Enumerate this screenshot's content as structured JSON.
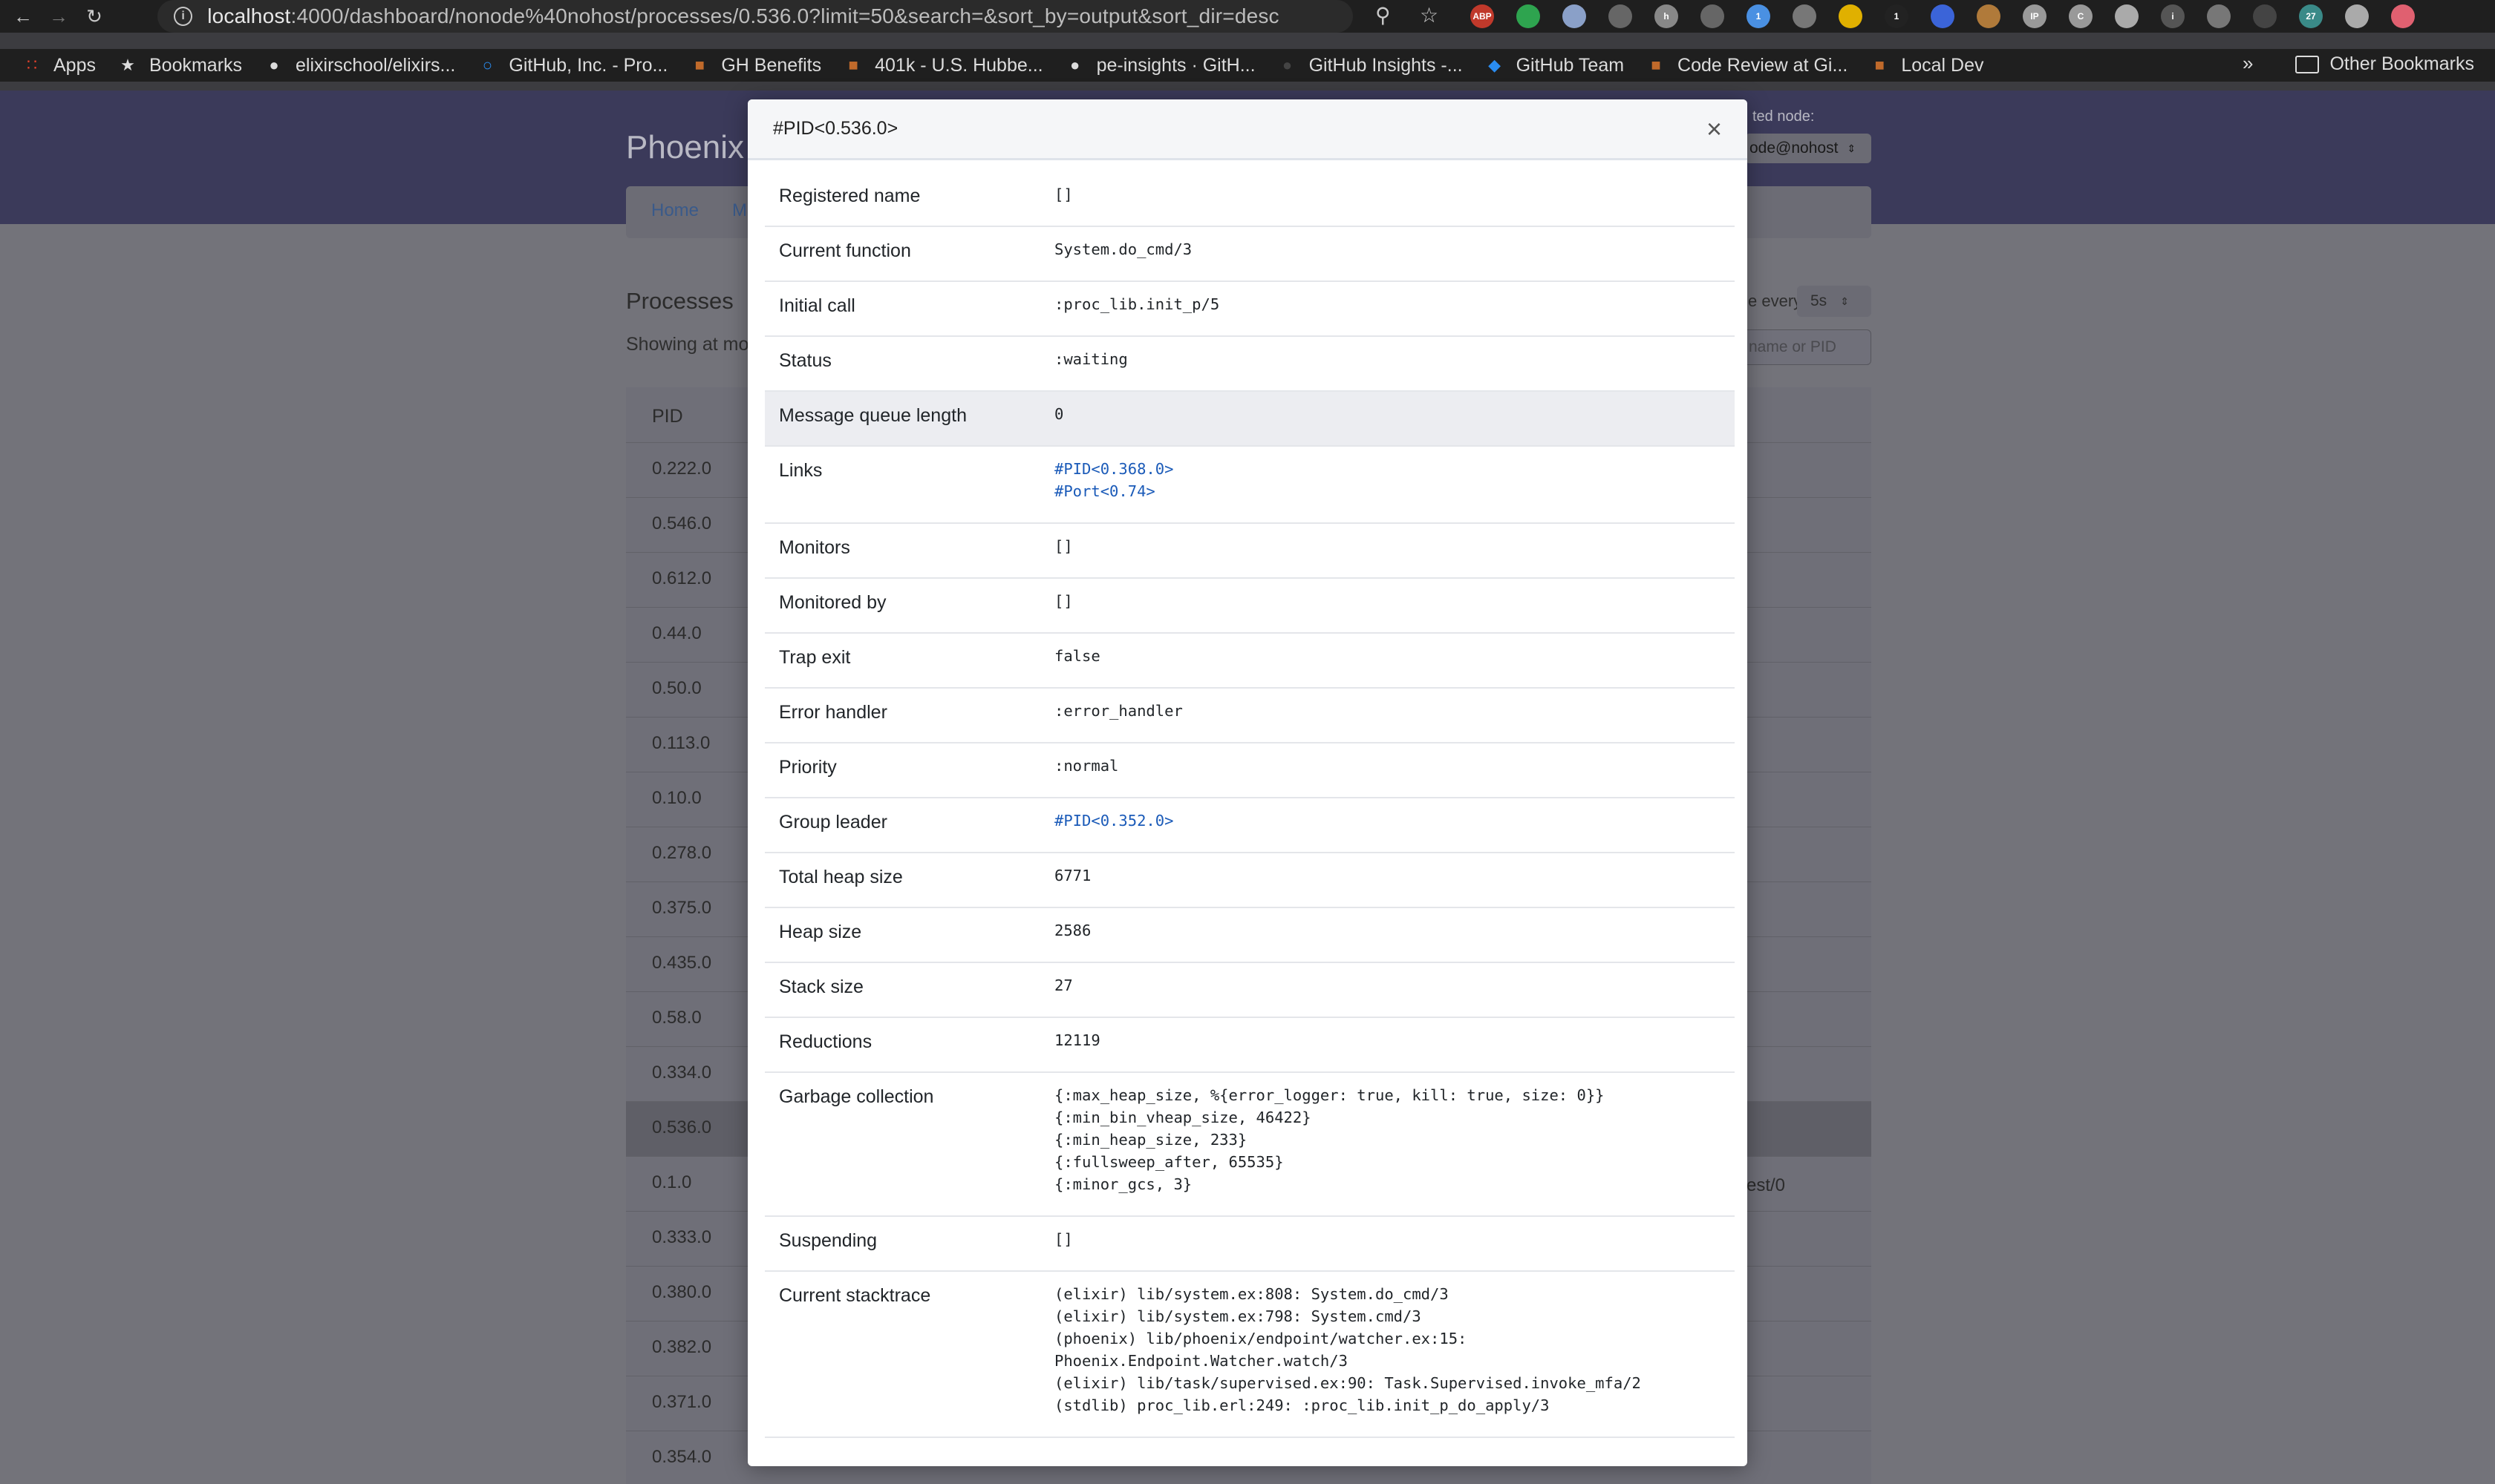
{
  "browser": {
    "url_host": "localhost",
    "url_path": ":4000/dashboard/nonode%40nohost/processes/0.536.0?limit=50&search=&sort_by=output&sort_dir=desc",
    "bookmarks": [
      {
        "label": "Apps",
        "icon": "apps-grid-icon",
        "color": "#e0402b"
      },
      {
        "label": "Bookmarks",
        "icon": "star-icon",
        "color": "#dcdcdc"
      },
      {
        "label": "elixirschool/elixirs...",
        "icon": "github-icon",
        "color": "#dcdcdc"
      },
      {
        "label": "GitHub, Inc. - Pro...",
        "icon": "ring-icon",
        "color": "#2a8cf0"
      },
      {
        "label": "GH Benefits",
        "icon": "folder-badge-icon",
        "color": "#c06a2b"
      },
      {
        "label": "401k - U.S. Hubbe...",
        "icon": "folder-badge-icon",
        "color": "#c06a2b"
      },
      {
        "label": "pe-insights · GitH...",
        "icon": "github-icon",
        "color": "#dcdcdc"
      },
      {
        "label": "GitHub Insights -...",
        "icon": "github-icon",
        "color": "#444"
      },
      {
        "label": "GitHub Team",
        "icon": "octocat-icon",
        "color": "#2a8cf0"
      },
      {
        "label": "Code Review at Gi...",
        "icon": "folder-badge-icon",
        "color": "#c06a2b"
      },
      {
        "label": "Local Dev",
        "icon": "folder-badge-icon",
        "color": "#c06a2b"
      }
    ],
    "other_bookmarks": "Other Bookmarks",
    "extensions": [
      {
        "name": "abp-icon",
        "text": "ABP",
        "color": "#c0392b"
      },
      {
        "name": "green-dot-icon",
        "text": "",
        "color": "#2ea44f"
      },
      {
        "name": "owl-icon",
        "text": "",
        "color": "#8aa0c8"
      },
      {
        "name": "target-icon",
        "text": "",
        "color": "#666"
      },
      {
        "name": "h-icon",
        "text": "h",
        "color": "#888"
      },
      {
        "name": "react-icon",
        "text": "",
        "color": "#666"
      },
      {
        "name": "chat-icon",
        "text": "1",
        "color": "#4a90e2"
      },
      {
        "name": "soccer-icon",
        "text": "",
        "color": "#777"
      },
      {
        "name": "flag-icon",
        "text": "",
        "color": "#e0b000"
      },
      {
        "name": "onepassword-icon",
        "text": "1",
        "color": "#222"
      },
      {
        "name": "check-icon",
        "text": "",
        "color": "#3b64d8"
      },
      {
        "name": "cookie-icon",
        "text": "",
        "color": "#b07a3a"
      },
      {
        "name": "ip-icon",
        "text": "IP",
        "color": "#999"
      },
      {
        "name": "c-icon",
        "text": "C",
        "color": "#999"
      },
      {
        "name": "calendar-icon",
        "text": "",
        "color": "#aaa"
      },
      {
        "name": "info-icon",
        "text": "i",
        "color": "#555"
      },
      {
        "name": "glasses-icon",
        "text": "",
        "color": "#777"
      },
      {
        "name": "a-icon",
        "text": "",
        "color": "#444"
      },
      {
        "name": "tab-27-icon",
        "text": "27",
        "color": "#3a8a88"
      },
      {
        "name": "avatar-icon",
        "text": "",
        "color": "#aaa"
      },
      {
        "name": "update-icon",
        "text": "",
        "color": "#e06070"
      }
    ]
  },
  "dashboard": {
    "brand": "Phoenix",
    "node_label": "ted node:",
    "node_value": "ode@nohost",
    "nav": {
      "home": "Home",
      "m": "M"
    },
    "processes_title": "Processes",
    "showing_text": "Showing at mo",
    "refresh_label": "e every",
    "refresh_value": "5s",
    "search_placeholder": "name or PID",
    "pid_header": "PID",
    "pids": [
      "0.222.0",
      "0.546.0",
      "0.612.0",
      "0.44.0",
      "0.50.0",
      "0.113.0",
      "0.10.0",
      "0.278.0",
      "0.375.0",
      "0.435.0",
      "0.58.0",
      "0.334.0",
      "0.536.0",
      "0.1.0",
      "0.333.0",
      "0.380.0",
      "0.382.0",
      "0.371.0",
      "0.354.0"
    ],
    "highlight_row": "0.536.0",
    "row_tail_text": "est/0"
  },
  "modal": {
    "title": "#PID<0.536.0>",
    "close_label": "×",
    "rows": [
      {
        "label": "Registered name",
        "value": "[]"
      },
      {
        "label": "Current function",
        "value": "System.do_cmd/3"
      },
      {
        "label": "Initial call",
        "value": ":proc_lib.init_p/5"
      },
      {
        "label": "Status",
        "value": ":waiting"
      },
      {
        "label": "Message queue length",
        "value": "0"
      },
      {
        "label": "Links",
        "links": [
          "#PID<0.368.0>",
          "#Port<0.74>"
        ]
      },
      {
        "label": "Monitors",
        "value": "[]"
      },
      {
        "label": "Monitored by",
        "value": "[]"
      },
      {
        "label": "Trap exit",
        "value": "false"
      },
      {
        "label": "Error handler",
        "value": ":error_handler"
      },
      {
        "label": "Priority",
        "value": ":normal"
      },
      {
        "label": "Group leader",
        "links": [
          "#PID<0.352.0>"
        ]
      },
      {
        "label": "Total heap size",
        "value": "6771"
      },
      {
        "label": "Heap size",
        "value": "2586"
      },
      {
        "label": "Stack size",
        "value": "27"
      },
      {
        "label": "Reductions",
        "value": "12119"
      },
      {
        "label": "Garbage collection",
        "value": "{:max_heap_size, %{error_logger: true, kill: true, size: 0}}\n{:min_bin_vheap_size, 46422}\n{:min_heap_size, 233}\n{:fullsweep_after, 65535}\n{:minor_gcs, 3}"
      },
      {
        "label": "Suspending",
        "value": "[]"
      },
      {
        "label": "Current stacktrace",
        "value": "(elixir) lib/system.ex:808: System.do_cmd/3\n(elixir) lib/system.ex:798: System.cmd/3\n(phoenix) lib/phoenix/endpoint/watcher.ex:15:\nPhoenix.Endpoint.Watcher.watch/3\n(elixir) lib/task/supervised.ex:90: Task.Supervised.invoke_mfa/2\n(stdlib) proc_lib.erl:249: :proc_lib.init_p_do_apply/3"
      }
    ],
    "active_row": "Message queue length"
  }
}
